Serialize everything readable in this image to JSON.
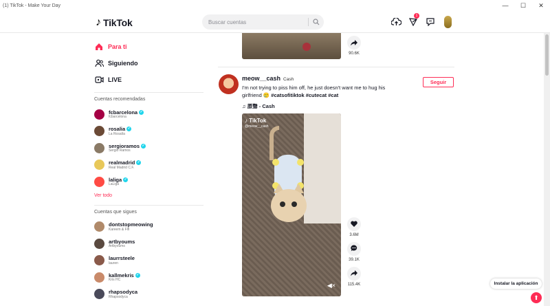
{
  "window": {
    "title": "(1) TikTok - Make Your Day"
  },
  "header": {
    "logo_text": "TikTok",
    "search": {
      "placeholder": "Buscar cuentas"
    },
    "inbox_badge": "1"
  },
  "sidebar": {
    "nav": [
      {
        "label": "Para ti",
        "icon": "home-icon",
        "active": true
      },
      {
        "label": "Siguiendo",
        "icon": "users-icon",
        "active": false
      },
      {
        "label": "LIVE",
        "icon": "live-icon",
        "active": false
      }
    ],
    "recommended_title": "Cuentas recomendadas",
    "recommended": [
      {
        "username": "fcbarcelona",
        "name": "fcbarcelona",
        "verified": true,
        "color": "#a50044"
      },
      {
        "username": "rosalia",
        "name": "La Rosalía",
        "verified": true,
        "color": "#6b4a36"
      },
      {
        "username": "sergioramos",
        "name": "Sergio Ramos",
        "verified": true,
        "color": "#8a7a66"
      },
      {
        "username": "realmadrid",
        "name": "Real Madrid C.F.",
        "verified": true,
        "color": "#e8c85a"
      },
      {
        "username": "laliga",
        "name": "LaLiga",
        "verified": true,
        "color": "#ff4b44"
      }
    ],
    "see_all": "Ver todo",
    "following_title": "Cuentas que sigues",
    "following": [
      {
        "username": "dontstopmeowing",
        "name": "Kareem & Fifi",
        "verified": false,
        "color": "#b08a6a"
      },
      {
        "username": "artbyoums",
        "name": "Artbyoums",
        "verified": false,
        "color": "#5a4a40"
      },
      {
        "username": "laurrsteele",
        "name": "lauren",
        "verified": false,
        "color": "#8a5a4a"
      },
      {
        "username": "kallmekris",
        "name": "Kris HC",
        "verified": true,
        "color": "#c98a6a"
      },
      {
        "username": "rhapsodyca",
        "name": "Rhapsodyca",
        "verified": false,
        "color": "#4a4a5a"
      }
    ]
  },
  "feed": {
    "previous": {
      "shares": "90.6K"
    },
    "post": {
      "username": "meow__cash",
      "nickname": "Cash",
      "description": "I'm not trying to piss him off, he just doesn't want me to hug his girlfriend 🥲",
      "hashtags": "#catsofitiktok #cutecat #cat",
      "music": "♫ 原聲 - Cash",
      "follow_label": "Seguir",
      "video_logo": "TikTok",
      "video_handle": "@meow__cash",
      "likes": "3.6M",
      "comments": "39.1K",
      "shares": "115.4K"
    }
  },
  "install_label": "Instalar la aplicación"
}
